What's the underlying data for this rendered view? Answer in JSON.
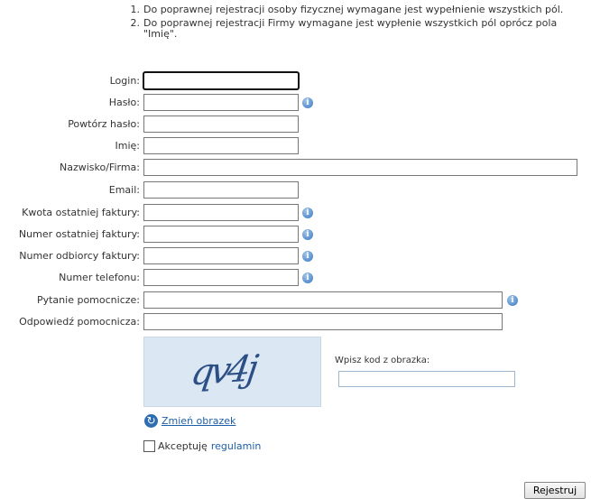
{
  "notes": [
    {
      "num": "1.",
      "text": "Do poprawnej rejestracji osoby fizycznej wymagane jest wypełnienie wszystkich pól."
    },
    {
      "num": "2.",
      "text": "Do poprawnej rejestracji Firmy wymagane jest wypłenie wszystkich pól oprócz pola \"Imię\"."
    }
  ],
  "form": {
    "login": {
      "label": "Login:",
      "value": ""
    },
    "password": {
      "label": "Hasło:",
      "value": ""
    },
    "password_repeat": {
      "label": "Powtórz hasło:",
      "value": ""
    },
    "first_name": {
      "label": "Imię:",
      "value": ""
    },
    "last_name_company": {
      "label": "Nazwisko/Firma:",
      "value": ""
    },
    "email": {
      "label": "Email:",
      "value": ""
    },
    "last_invoice_amount": {
      "label": "Kwota ostatniej faktury:",
      "value": ""
    },
    "last_invoice_number": {
      "label": "Numer ostatniej faktury:",
      "value": ""
    },
    "invoice_recipient_number": {
      "label": "Numer odbiorcy faktury:",
      "value": ""
    },
    "phone": {
      "label": "Numer telefonu:",
      "value": ""
    },
    "security_question": {
      "label": "Pytanie pomocnicze:",
      "value": ""
    },
    "security_answer": {
      "label": "Odpowiedź pomocnicza:",
      "value": ""
    }
  },
  "captcha": {
    "image_text": "qv4j",
    "prompt": "Wpisz kod z obrazka:",
    "value": "",
    "refresh_label": "Zmień obrazek"
  },
  "accept": {
    "text": "Akceptuję",
    "link": "regulamin"
  },
  "submit_label": "Rejestruj",
  "colors": {
    "link": "#1d5ea8",
    "info_icon": "#3a78c2",
    "captcha_bg": "#dbe8f4"
  },
  "icons": {
    "info": "info-icon",
    "refresh": "refresh-icon"
  }
}
